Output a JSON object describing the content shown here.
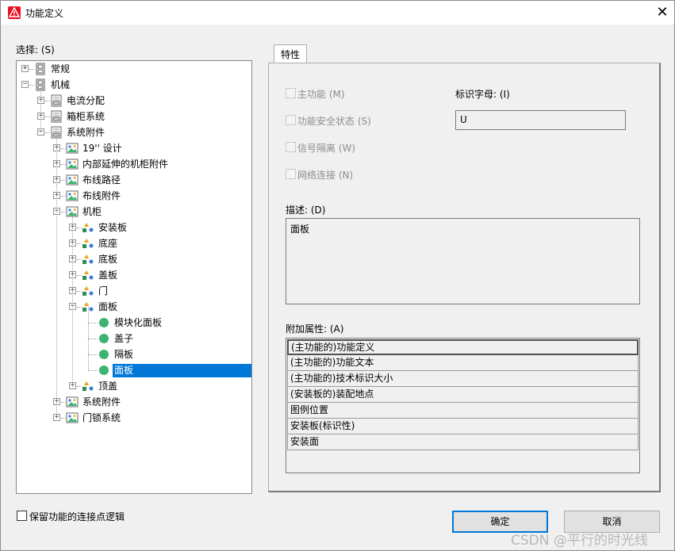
{
  "window": {
    "title": "功能定义"
  },
  "select_label": "选择: (S)",
  "tree": [
    {
      "label": "常规",
      "icon": "cabinet-icon",
      "expander": "+"
    },
    {
      "label": "机械",
      "icon": "cabinet-icon",
      "expander": "-"
    },
    {
      "label": "电流分配",
      "icon": "rack-icon",
      "expander": "+"
    },
    {
      "label": "箱柜系统",
      "icon": "rack-icon",
      "expander": "+"
    },
    {
      "label": "系统附件",
      "icon": "rack-icon",
      "expander": "-"
    },
    {
      "label": "19'' 设计",
      "icon": "picture-icon",
      "expander": "+"
    },
    {
      "label": "内部延伸的机柜附件",
      "icon": "picture-icon",
      "expander": "+"
    },
    {
      "label": "布线路径",
      "icon": "picture-icon",
      "expander": "+"
    },
    {
      "label": "布线附件",
      "icon": "picture-icon",
      "expander": "+"
    },
    {
      "label": "机柜",
      "icon": "picture-icon",
      "expander": "-"
    },
    {
      "label": "安装板",
      "icon": "shapes-icon",
      "expander": "+"
    },
    {
      "label": "底座",
      "icon": "shapes-icon",
      "expander": "+"
    },
    {
      "label": "底板",
      "icon": "shapes-icon",
      "expander": "+"
    },
    {
      "label": "盖板",
      "icon": "shapes-icon",
      "expander": "+"
    },
    {
      "label": "门",
      "icon": "shapes-icon",
      "expander": "+"
    },
    {
      "label": "面板",
      "icon": "shapes-icon",
      "expander": "-"
    },
    {
      "label": "模块化面板",
      "icon": "green-dot-icon",
      "expander": ""
    },
    {
      "label": "盖子",
      "icon": "green-dot-icon",
      "expander": ""
    },
    {
      "label": "隔板",
      "icon": "green-dot-icon",
      "expander": ""
    },
    {
      "label": "面板",
      "icon": "green-dot-icon",
      "expander": "",
      "selected": true
    },
    {
      "label": "顶盖",
      "icon": "shapes-icon",
      "expander": "+"
    },
    {
      "label": "系统附件",
      "icon": "picture-icon",
      "expander": "+"
    },
    {
      "label": "门锁系统",
      "icon": "picture-icon",
      "expander": "+"
    }
  ],
  "tab_label": "特性",
  "checkboxes": [
    {
      "label": "主功能 (M)",
      "checked": false,
      "enabled": false
    },
    {
      "label": "功能安全状态 (S)",
      "checked": false,
      "enabled": false
    },
    {
      "label": "信号隔离 (W)",
      "checked": false,
      "enabled": false
    },
    {
      "label": "网络连接 (N)",
      "checked": false,
      "enabled": false
    }
  ],
  "identifier": {
    "label": "标识字母: (I)",
    "value": "U"
  },
  "description": {
    "label": "描述: (D)",
    "value": "面板"
  },
  "attributes": {
    "label": "附加属性: (A)",
    "items": [
      "(主功能的)功能定义",
      "(主功能的)功能文本",
      "(主功能的)技术标识大小",
      "(安装板的)装配地点",
      "图例位置",
      "安装板(标识性)",
      "安装面"
    ]
  },
  "keep_logic": {
    "label": "保留功能的连接点逻辑",
    "checked": false
  },
  "buttons": {
    "ok": "确定",
    "cancel": "取消"
  },
  "watermark": "CSDN @平行的时光线",
  "colors": {
    "selection": "#0078d7",
    "green_dot": "#3cb371",
    "app_icon": "#e81123"
  }
}
